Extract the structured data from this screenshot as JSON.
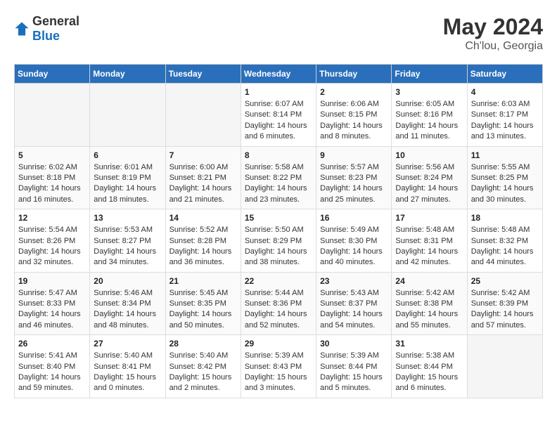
{
  "header": {
    "logo_general": "General",
    "logo_blue": "Blue",
    "title": "May 2024",
    "location": "Ch'lou, Georgia"
  },
  "days_of_week": [
    "Sunday",
    "Monday",
    "Tuesday",
    "Wednesday",
    "Thursday",
    "Friday",
    "Saturday"
  ],
  "weeks": [
    [
      {
        "day": "",
        "info": ""
      },
      {
        "day": "",
        "info": ""
      },
      {
        "day": "",
        "info": ""
      },
      {
        "day": "1",
        "info": "Sunrise: 6:07 AM\nSunset: 8:14 PM\nDaylight: 14 hours\nand 6 minutes."
      },
      {
        "day": "2",
        "info": "Sunrise: 6:06 AM\nSunset: 8:15 PM\nDaylight: 14 hours\nand 8 minutes."
      },
      {
        "day": "3",
        "info": "Sunrise: 6:05 AM\nSunset: 8:16 PM\nDaylight: 14 hours\nand 11 minutes."
      },
      {
        "day": "4",
        "info": "Sunrise: 6:03 AM\nSunset: 8:17 PM\nDaylight: 14 hours\nand 13 minutes."
      }
    ],
    [
      {
        "day": "5",
        "info": "Sunrise: 6:02 AM\nSunset: 8:18 PM\nDaylight: 14 hours\nand 16 minutes."
      },
      {
        "day": "6",
        "info": "Sunrise: 6:01 AM\nSunset: 8:19 PM\nDaylight: 14 hours\nand 18 minutes."
      },
      {
        "day": "7",
        "info": "Sunrise: 6:00 AM\nSunset: 8:21 PM\nDaylight: 14 hours\nand 21 minutes."
      },
      {
        "day": "8",
        "info": "Sunrise: 5:58 AM\nSunset: 8:22 PM\nDaylight: 14 hours\nand 23 minutes."
      },
      {
        "day": "9",
        "info": "Sunrise: 5:57 AM\nSunset: 8:23 PM\nDaylight: 14 hours\nand 25 minutes."
      },
      {
        "day": "10",
        "info": "Sunrise: 5:56 AM\nSunset: 8:24 PM\nDaylight: 14 hours\nand 27 minutes."
      },
      {
        "day": "11",
        "info": "Sunrise: 5:55 AM\nSunset: 8:25 PM\nDaylight: 14 hours\nand 30 minutes."
      }
    ],
    [
      {
        "day": "12",
        "info": "Sunrise: 5:54 AM\nSunset: 8:26 PM\nDaylight: 14 hours\nand 32 minutes."
      },
      {
        "day": "13",
        "info": "Sunrise: 5:53 AM\nSunset: 8:27 PM\nDaylight: 14 hours\nand 34 minutes."
      },
      {
        "day": "14",
        "info": "Sunrise: 5:52 AM\nSunset: 8:28 PM\nDaylight: 14 hours\nand 36 minutes."
      },
      {
        "day": "15",
        "info": "Sunrise: 5:50 AM\nSunset: 8:29 PM\nDaylight: 14 hours\nand 38 minutes."
      },
      {
        "day": "16",
        "info": "Sunrise: 5:49 AM\nSunset: 8:30 PM\nDaylight: 14 hours\nand 40 minutes."
      },
      {
        "day": "17",
        "info": "Sunrise: 5:48 AM\nSunset: 8:31 PM\nDaylight: 14 hours\nand 42 minutes."
      },
      {
        "day": "18",
        "info": "Sunrise: 5:48 AM\nSunset: 8:32 PM\nDaylight: 14 hours\nand 44 minutes."
      }
    ],
    [
      {
        "day": "19",
        "info": "Sunrise: 5:47 AM\nSunset: 8:33 PM\nDaylight: 14 hours\nand 46 minutes."
      },
      {
        "day": "20",
        "info": "Sunrise: 5:46 AM\nSunset: 8:34 PM\nDaylight: 14 hours\nand 48 minutes."
      },
      {
        "day": "21",
        "info": "Sunrise: 5:45 AM\nSunset: 8:35 PM\nDaylight: 14 hours\nand 50 minutes."
      },
      {
        "day": "22",
        "info": "Sunrise: 5:44 AM\nSunset: 8:36 PM\nDaylight: 14 hours\nand 52 minutes."
      },
      {
        "day": "23",
        "info": "Sunrise: 5:43 AM\nSunset: 8:37 PM\nDaylight: 14 hours\nand 54 minutes."
      },
      {
        "day": "24",
        "info": "Sunrise: 5:42 AM\nSunset: 8:38 PM\nDaylight: 14 hours\nand 55 minutes."
      },
      {
        "day": "25",
        "info": "Sunrise: 5:42 AM\nSunset: 8:39 PM\nDaylight: 14 hours\nand 57 minutes."
      }
    ],
    [
      {
        "day": "26",
        "info": "Sunrise: 5:41 AM\nSunset: 8:40 PM\nDaylight: 14 hours\nand 59 minutes."
      },
      {
        "day": "27",
        "info": "Sunrise: 5:40 AM\nSunset: 8:41 PM\nDaylight: 15 hours\nand 0 minutes."
      },
      {
        "day": "28",
        "info": "Sunrise: 5:40 AM\nSunset: 8:42 PM\nDaylight: 15 hours\nand 2 minutes."
      },
      {
        "day": "29",
        "info": "Sunrise: 5:39 AM\nSunset: 8:43 PM\nDaylight: 15 hours\nand 3 minutes."
      },
      {
        "day": "30",
        "info": "Sunrise: 5:39 AM\nSunset: 8:44 PM\nDaylight: 15 hours\nand 5 minutes."
      },
      {
        "day": "31",
        "info": "Sunrise: 5:38 AM\nSunset: 8:44 PM\nDaylight: 15 hours\nand 6 minutes."
      },
      {
        "day": "",
        "info": ""
      }
    ]
  ]
}
